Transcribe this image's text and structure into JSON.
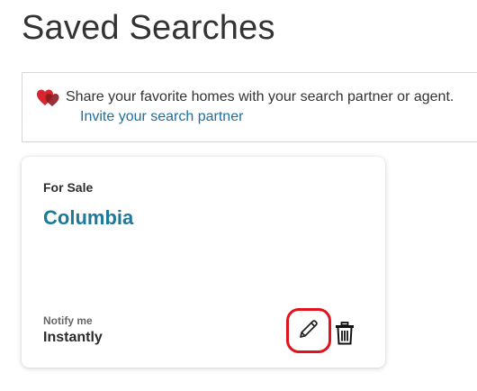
{
  "page": {
    "title": "Saved Searches"
  },
  "share_banner": {
    "icon": "hearts-icon",
    "text": "Share your favorite homes with your search partner or agent.",
    "invite_link": "Invite your search partner"
  },
  "saved_searches": [
    {
      "type": "For Sale",
      "location": "Columbia",
      "notify_label": "Notify me",
      "notify_value": "Instantly",
      "actions": {
        "edit_icon": "pencil-icon",
        "delete_icon": "trash-icon"
      }
    }
  ],
  "colors": {
    "link": "#1e6f9c",
    "location": "#1e7898",
    "highlight_ring": "#e0131f",
    "heart_red": "#d7262f",
    "heart_dark": "#8e1b22"
  }
}
